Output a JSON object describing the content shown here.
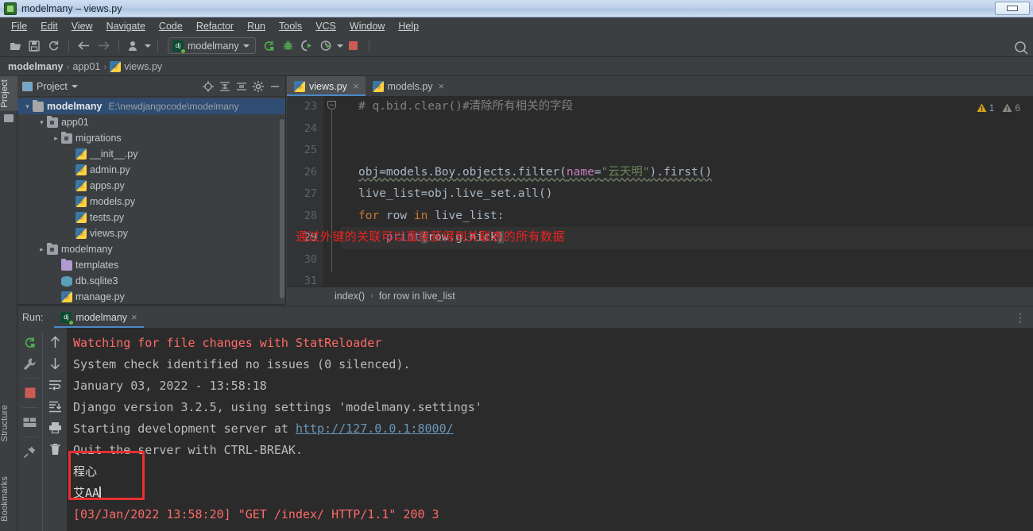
{
  "window": {
    "title": "modelmany – views.py",
    "icon": "pycharm-icon",
    "minimize_label": "minimize"
  },
  "menubar": {
    "items": [
      {
        "label": "File",
        "mnemonic": "F"
      },
      {
        "label": "Edit",
        "mnemonic": "E"
      },
      {
        "label": "View",
        "mnemonic": "V"
      },
      {
        "label": "Navigate",
        "mnemonic": "N"
      },
      {
        "label": "Code",
        "mnemonic": "C"
      },
      {
        "label": "Refactor",
        "mnemonic": "R"
      },
      {
        "label": "Run",
        "mnemonic": "u"
      },
      {
        "label": "Tools",
        "mnemonic": "T"
      },
      {
        "label": "VCS",
        "mnemonic": "S"
      },
      {
        "label": "Window",
        "mnemonic": "W"
      },
      {
        "label": "Help",
        "mnemonic": "H"
      }
    ]
  },
  "toolbar": {
    "icons": [
      "open-folder-icon",
      "save-icon",
      "sync-icon",
      "back-arrow-icon",
      "forward-arrow-icon",
      "vcs-user-icon"
    ],
    "run_config": {
      "label": "modelmany",
      "icon": "django-icon"
    },
    "run_icon": "run-icon",
    "debug_icon": "debug-icon",
    "run_coverage_icon": "run-with-coverage-icon",
    "profile_icon": "profile-icon",
    "stop_icon": "stop-icon",
    "search_icon": "search-icon"
  },
  "breadcrumb": {
    "items": [
      {
        "label": "modelmany",
        "icon": ""
      },
      {
        "label": "app01",
        "icon": ""
      },
      {
        "label": "views.py",
        "icon": "python-file-icon"
      }
    ],
    "separator": "›"
  },
  "left_strip": {
    "top": [
      {
        "label": "Project",
        "active": true
      }
    ],
    "bottom": [
      {
        "label": "Structure"
      },
      {
        "label": "Bookmarks"
      }
    ]
  },
  "project_panel": {
    "title": "Project",
    "tools": [
      "locate-icon",
      "expand-all-icon",
      "collapse-all-icon",
      "settings-gear-icon",
      "hide-panel-icon"
    ],
    "tree": [
      {
        "label": "modelmany",
        "path": "E:\\newdjangocode\\modelmany",
        "icon": "folder-icon",
        "indent": 0,
        "arrow": "open",
        "bold": true,
        "selected": true
      },
      {
        "label": "app01",
        "path": "",
        "icon": "module-folder-icon",
        "indent": 1,
        "arrow": "open",
        "bold": false,
        "selected": false
      },
      {
        "label": "migrations",
        "path": "",
        "icon": "module-folder-icon",
        "indent": 2,
        "arrow": "closed",
        "bold": false,
        "selected": false
      },
      {
        "label": "__init__.py",
        "path": "",
        "icon": "python-file-icon",
        "indent": 3,
        "arrow": "none",
        "bold": false,
        "selected": false
      },
      {
        "label": "admin.py",
        "path": "",
        "icon": "python-file-icon",
        "indent": 3,
        "arrow": "none",
        "bold": false,
        "selected": false
      },
      {
        "label": "apps.py",
        "path": "",
        "icon": "python-file-icon",
        "indent": 3,
        "arrow": "none",
        "bold": false,
        "selected": false
      },
      {
        "label": "models.py",
        "path": "",
        "icon": "python-file-icon",
        "indent": 3,
        "arrow": "none",
        "bold": false,
        "selected": false
      },
      {
        "label": "tests.py",
        "path": "",
        "icon": "python-file-icon",
        "indent": 3,
        "arrow": "none",
        "bold": false,
        "selected": false
      },
      {
        "label": "views.py",
        "path": "",
        "icon": "python-file-icon",
        "indent": 3,
        "arrow": "none",
        "bold": false,
        "selected": false
      },
      {
        "label": "modelmany",
        "path": "",
        "icon": "module-folder-icon",
        "indent": 1,
        "arrow": "closed",
        "bold": false,
        "selected": false
      },
      {
        "label": "templates",
        "path": "",
        "icon": "templates-folder-icon",
        "indent": 2,
        "arrow": "none",
        "bold": false,
        "selected": false
      },
      {
        "label": "db.sqlite3",
        "path": "",
        "icon": "database-icon",
        "indent": 2,
        "arrow": "none",
        "bold": false,
        "selected": false
      },
      {
        "label": "manage.py",
        "path": "",
        "icon": "python-file-icon",
        "indent": 2,
        "arrow": "none",
        "bold": false,
        "selected": false
      }
    ]
  },
  "editor": {
    "tabs": [
      {
        "label": "views.py",
        "active": true,
        "icon": "python-file-icon"
      },
      {
        "label": "models.py",
        "active": false,
        "icon": "python-file-icon"
      }
    ],
    "line_numbers": [
      "23",
      "24",
      "25",
      "26",
      "27",
      "28",
      "29",
      "30",
      "31"
    ],
    "current_line": "29",
    "lines": [
      {
        "n": "23",
        "text": "# q.bid.clear()#清除所有相关的字段"
      },
      {
        "n": "24",
        "text": ""
      },
      {
        "n": "25",
        "text": ""
      },
      {
        "n": "26",
        "text": "obj=models.Boy.objects.filter(name=\"云天明\").first()"
      },
      {
        "n": "27",
        "text": "live_list=obj.live_set.all()"
      },
      {
        "n": "28",
        "text": "for row in live_list:"
      },
      {
        "n": "29",
        "text": "    print(row.g.nick)"
      },
      {
        "n": "30",
        "text": ""
      },
      {
        "n": "31",
        "text": ""
      }
    ],
    "code_tokens": {
      "l23_comment": "# q.bid.clear()#清除所有相关的字段",
      "l26_a": "obj=models.Boy.objects.filter(",
      "l26_param": "name",
      "l26_eq": "=",
      "l26_str": "\"云天明\"",
      "l26_b": ").first()",
      "l27": "live_list=obj.live_set.all()",
      "l28_kw1": "for",
      "l28_mid": " row ",
      "l28_kw2": "in",
      "l28_rest": " live_list:",
      "l29_indent": "    ",
      "l29_fn": "print",
      "l29_open": "(",
      "l29_args": "row.g.nick",
      "l29_close": ")"
    },
    "annotation": "通过外键的关联可以直接获得到关联表的所有数据",
    "warnings": [
      {
        "icon": "warning-icon",
        "count": "1",
        "severity": "warning"
      },
      {
        "icon": "weak-warning-icon",
        "count": "6",
        "severity": "weak"
      }
    ],
    "status_breadcrumb": [
      {
        "label": "index()"
      },
      {
        "label": "for row in live_list"
      }
    ],
    "status_separator": "›"
  },
  "run_panel": {
    "label": "Run:",
    "tab": {
      "label": "modelmany",
      "icon": "django-icon",
      "close": "×"
    },
    "menu_icon": "more-options-icon",
    "tools_left": [
      "rerun-icon",
      "settings-wrench-icon",
      "stop-icon",
      "layout-icon",
      "pin-icon"
    ],
    "tools_right": [
      "up-arrow-icon",
      "down-arrow-icon",
      "soft-wrap-icon",
      "scroll-to-end-icon",
      "print-icon",
      "trash-icon"
    ],
    "console": [
      {
        "text": "Watching for file changes with StatReloader",
        "style": "red"
      },
      {
        "text": "System check identified no issues (0 silenced).",
        "style": "gray"
      },
      {
        "text": "January 03, 2022 - 13:58:18",
        "style": "gray"
      },
      {
        "text": "Django version 3.2.5, using settings 'modelmany.settings'",
        "style": "gray"
      },
      {
        "text": "Starting development server at ",
        "style": "gray",
        "link": "http://127.0.0.1:8000/"
      },
      {
        "text": "Quit the server with CTRL-BREAK.",
        "style": "gray"
      },
      {
        "text": "程心",
        "style": "white",
        "highlighted": true
      },
      {
        "text": "艾AA",
        "style": "white",
        "highlighted": true
      },
      {
        "text": "[03/Jan/2022 13:58:20] \"GET /index/ HTTP/1.1\" 200 3",
        "style": "red"
      }
    ],
    "highlight_box_color": "#e83030"
  },
  "colors": {
    "accent": "#4a88c7",
    "editor_bg": "#2b2b2b",
    "panel_bg": "#3c3f41",
    "selection": "#2f4d72",
    "error_red": "#ff6b68",
    "annotation_red": "#ee2222",
    "string_green": "#6a8759",
    "keyword_orange": "#cc7832",
    "function_yellow": "#ffc66d"
  }
}
